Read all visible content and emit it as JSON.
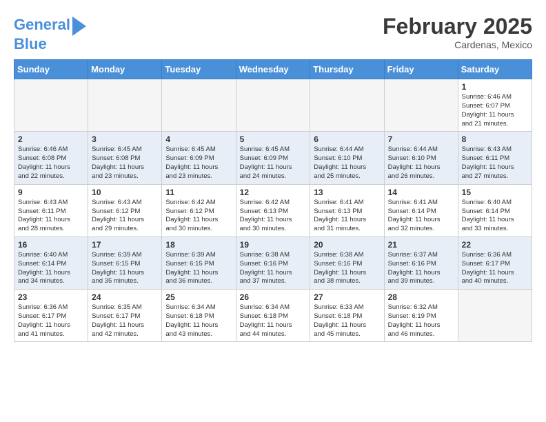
{
  "header": {
    "logo_line1": "General",
    "logo_line2": "Blue",
    "title": "February 2025",
    "subtitle": "Cardenas, Mexico"
  },
  "days_of_week": [
    "Sunday",
    "Monday",
    "Tuesday",
    "Wednesday",
    "Thursday",
    "Friday",
    "Saturday"
  ],
  "weeks": [
    {
      "row_style": "even",
      "days": [
        {
          "num": "",
          "info": "",
          "empty": true
        },
        {
          "num": "",
          "info": "",
          "empty": true
        },
        {
          "num": "",
          "info": "",
          "empty": true
        },
        {
          "num": "",
          "info": "",
          "empty": true
        },
        {
          "num": "",
          "info": "",
          "empty": true
        },
        {
          "num": "",
          "info": "",
          "empty": true
        },
        {
          "num": "1",
          "info": "Sunrise: 6:46 AM\nSunset: 6:07 PM\nDaylight: 11 hours\nand 21 minutes.",
          "empty": false
        }
      ]
    },
    {
      "row_style": "odd",
      "days": [
        {
          "num": "2",
          "info": "Sunrise: 6:46 AM\nSunset: 6:08 PM\nDaylight: 11 hours\nand 22 minutes.",
          "empty": false
        },
        {
          "num": "3",
          "info": "Sunrise: 6:45 AM\nSunset: 6:08 PM\nDaylight: 11 hours\nand 23 minutes.",
          "empty": false
        },
        {
          "num": "4",
          "info": "Sunrise: 6:45 AM\nSunset: 6:09 PM\nDaylight: 11 hours\nand 23 minutes.",
          "empty": false
        },
        {
          "num": "5",
          "info": "Sunrise: 6:45 AM\nSunset: 6:09 PM\nDaylight: 11 hours\nand 24 minutes.",
          "empty": false
        },
        {
          "num": "6",
          "info": "Sunrise: 6:44 AM\nSunset: 6:10 PM\nDaylight: 11 hours\nand 25 minutes.",
          "empty": false
        },
        {
          "num": "7",
          "info": "Sunrise: 6:44 AM\nSunset: 6:10 PM\nDaylight: 11 hours\nand 26 minutes.",
          "empty": false
        },
        {
          "num": "8",
          "info": "Sunrise: 6:43 AM\nSunset: 6:11 PM\nDaylight: 11 hours\nand 27 minutes.",
          "empty": false
        }
      ]
    },
    {
      "row_style": "even",
      "days": [
        {
          "num": "9",
          "info": "Sunrise: 6:43 AM\nSunset: 6:11 PM\nDaylight: 11 hours\nand 28 minutes.",
          "empty": false
        },
        {
          "num": "10",
          "info": "Sunrise: 6:43 AM\nSunset: 6:12 PM\nDaylight: 11 hours\nand 29 minutes.",
          "empty": false
        },
        {
          "num": "11",
          "info": "Sunrise: 6:42 AM\nSunset: 6:12 PM\nDaylight: 11 hours\nand 30 minutes.",
          "empty": false
        },
        {
          "num": "12",
          "info": "Sunrise: 6:42 AM\nSunset: 6:13 PM\nDaylight: 11 hours\nand 30 minutes.",
          "empty": false
        },
        {
          "num": "13",
          "info": "Sunrise: 6:41 AM\nSunset: 6:13 PM\nDaylight: 11 hours\nand 31 minutes.",
          "empty": false
        },
        {
          "num": "14",
          "info": "Sunrise: 6:41 AM\nSunset: 6:14 PM\nDaylight: 11 hours\nand 32 minutes.",
          "empty": false
        },
        {
          "num": "15",
          "info": "Sunrise: 6:40 AM\nSunset: 6:14 PM\nDaylight: 11 hours\nand 33 minutes.",
          "empty": false
        }
      ]
    },
    {
      "row_style": "odd",
      "days": [
        {
          "num": "16",
          "info": "Sunrise: 6:40 AM\nSunset: 6:14 PM\nDaylight: 11 hours\nand 34 minutes.",
          "empty": false
        },
        {
          "num": "17",
          "info": "Sunrise: 6:39 AM\nSunset: 6:15 PM\nDaylight: 11 hours\nand 35 minutes.",
          "empty": false
        },
        {
          "num": "18",
          "info": "Sunrise: 6:39 AM\nSunset: 6:15 PM\nDaylight: 11 hours\nand 36 minutes.",
          "empty": false
        },
        {
          "num": "19",
          "info": "Sunrise: 6:38 AM\nSunset: 6:16 PM\nDaylight: 11 hours\nand 37 minutes.",
          "empty": false
        },
        {
          "num": "20",
          "info": "Sunrise: 6:38 AM\nSunset: 6:16 PM\nDaylight: 11 hours\nand 38 minutes.",
          "empty": false
        },
        {
          "num": "21",
          "info": "Sunrise: 6:37 AM\nSunset: 6:16 PM\nDaylight: 11 hours\nand 39 minutes.",
          "empty": false
        },
        {
          "num": "22",
          "info": "Sunrise: 6:36 AM\nSunset: 6:17 PM\nDaylight: 11 hours\nand 40 minutes.",
          "empty": false
        }
      ]
    },
    {
      "row_style": "even",
      "days": [
        {
          "num": "23",
          "info": "Sunrise: 6:36 AM\nSunset: 6:17 PM\nDaylight: 11 hours\nand 41 minutes.",
          "empty": false
        },
        {
          "num": "24",
          "info": "Sunrise: 6:35 AM\nSunset: 6:17 PM\nDaylight: 11 hours\nand 42 minutes.",
          "empty": false
        },
        {
          "num": "25",
          "info": "Sunrise: 6:34 AM\nSunset: 6:18 PM\nDaylight: 11 hours\nand 43 minutes.",
          "empty": false
        },
        {
          "num": "26",
          "info": "Sunrise: 6:34 AM\nSunset: 6:18 PM\nDaylight: 11 hours\nand 44 minutes.",
          "empty": false
        },
        {
          "num": "27",
          "info": "Sunrise: 6:33 AM\nSunset: 6:18 PM\nDaylight: 11 hours\nand 45 minutes.",
          "empty": false
        },
        {
          "num": "28",
          "info": "Sunrise: 6:32 AM\nSunset: 6:19 PM\nDaylight: 11 hours\nand 46 minutes.",
          "empty": false
        },
        {
          "num": "",
          "info": "",
          "empty": true
        }
      ]
    }
  ]
}
